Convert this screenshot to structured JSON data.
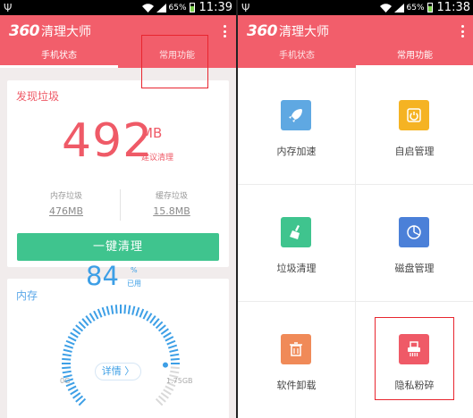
{
  "colors": {
    "brand": "#f25e6b",
    "accent_red": "#ef5a67",
    "green": "#3fc48e",
    "blue": "#3d9fe6",
    "highlight": "#e8262f"
  },
  "left": {
    "status": {
      "battery": "65%",
      "time": "11:39"
    },
    "app_title_num": "360",
    "app_title_cn": "清理大师",
    "tabs": [
      "手机状态",
      "常用功能"
    ],
    "active_tab": 0,
    "junk_card": {
      "title": "发现垃圾",
      "amount": "492",
      "unit": "MB",
      "hint": "建议清理",
      "stats": [
        {
          "label": "内存垃圾",
          "value": "476MB"
        },
        {
          "label": "缓存垃圾",
          "value": "15.8MB"
        }
      ],
      "button": "一键清理"
    },
    "memory_card": {
      "title": "内存",
      "percent": "84",
      "pct_sign": "%",
      "used": "已用",
      "detail_button": "详情 〉",
      "min": "0G",
      "max": "1.75GB",
      "usage_fraction": 0.84
    }
  },
  "right": {
    "status": {
      "battery": "65%",
      "time": "11:38"
    },
    "app_title_num": "360",
    "app_title_cn": "清理大师",
    "tabs": [
      "手机状态",
      "常用功能"
    ],
    "active_tab": 1,
    "tools": [
      {
        "label": "内存加速",
        "icon": "rocket-icon",
        "color": "#5fa8e2"
      },
      {
        "label": "自启管理",
        "icon": "power-icon",
        "color": "#f5b323"
      },
      {
        "label": "垃圾清理",
        "icon": "broom-icon",
        "color": "#3fc48e"
      },
      {
        "label": "磁盘管理",
        "icon": "pie-chart-icon",
        "color": "#4b80d8"
      },
      {
        "label": "软件卸载",
        "icon": "trash-icon",
        "color": "#f08a58"
      },
      {
        "label": "隐私粉碎",
        "icon": "shredder-icon",
        "color": "#ef5a67"
      }
    ]
  }
}
